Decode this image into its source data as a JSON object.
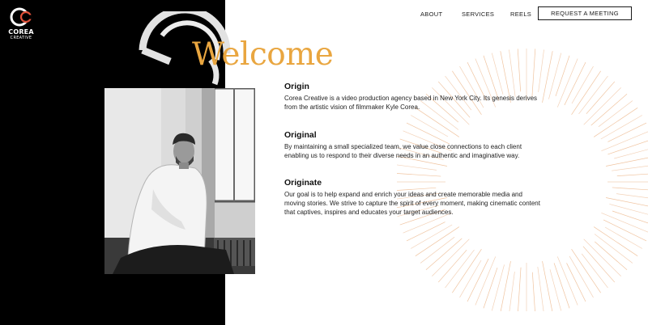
{
  "brand": {
    "name": "COREA",
    "tagline": "CREATIVE",
    "accent_color": "#e9a640",
    "logo_accent_color": "#e0513a"
  },
  "nav": {
    "links": [
      {
        "label": "ABOUT"
      },
      {
        "label": "SERVICES"
      },
      {
        "label": "REELS"
      }
    ],
    "cta_label": "REQUEST A MEETING"
  },
  "hero": {
    "heading": "Welcome",
    "photo_icon": "portrait-photo"
  },
  "sections": [
    {
      "title": "Origin",
      "body": "Corea Creative is a video production agency based in New York City. Its genesis derives from the artistic vision of filmmaker Kyle Corea."
    },
    {
      "title": "Original",
      "body": "By maintaining a small specialized team, we value close connections to each client enabling us to respond to their diverse needs in an authentic and imaginative way."
    },
    {
      "title": "Originate",
      "body": "Our goal is to help expand and enrich your ideas and create memorable media and moving stories. We strive to capture the spirit of every moment, making cinematic content that captives, inspires and educates your target audiences."
    }
  ]
}
